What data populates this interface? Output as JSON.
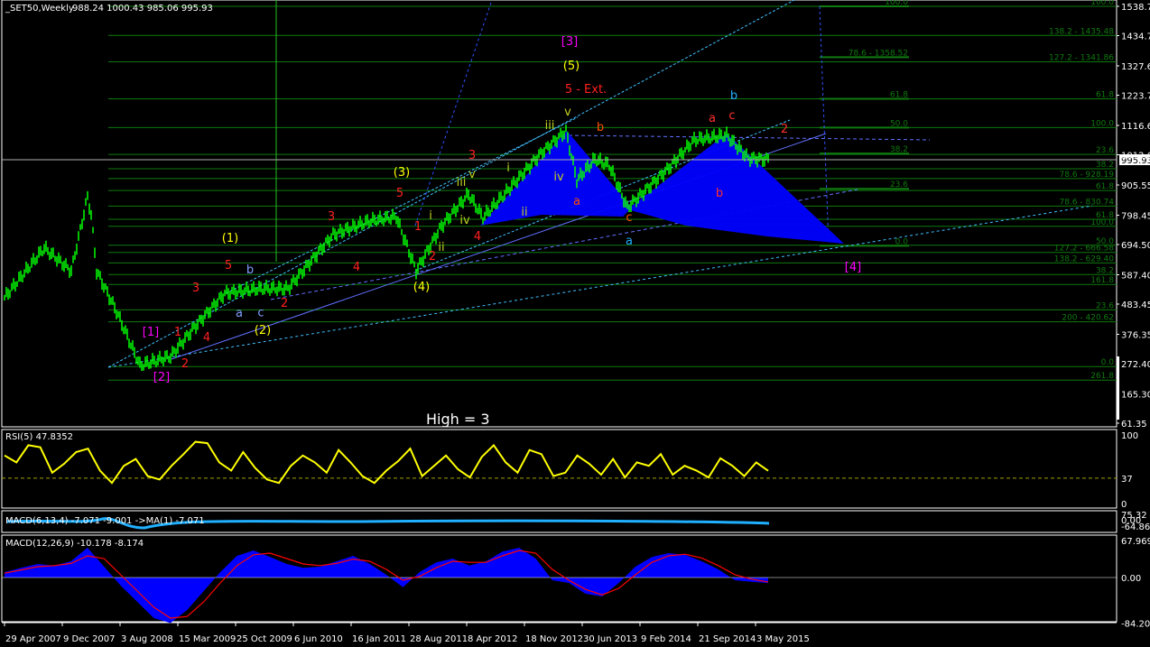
{
  "header": {
    "symbol": "_SET50,Weekly",
    "ohlc": "988.24 1000.43 985.06 995.93"
  },
  "current_price_label": "995.93",
  "annotation_text": "High = 3",
  "colors": {
    "bars": "#00ff00",
    "fib": "#0f7a0f",
    "pattern": "#0000ff",
    "rsi": "#ffff00",
    "macd_signal": "#ff0000",
    "trend_cyan": "#40c0ff",
    "trend_blue": "#4040ff"
  },
  "chart_data": [
    {
      "type": "line",
      "title": "_SET50,Weekly",
      "x_unit": "weeks since 29 Apr 2007",
      "ylim": [
        61.35,
        1538.7
      ],
      "y_ticks": [
        "1538.70",
        "1434.75",
        "1327.65",
        "1223.70",
        "1116.60",
        "1012.65",
        "905.55",
        "798.45",
        "694.50",
        "587.40",
        "483.45",
        "376.35",
        "272.40",
        "165.30",
        "61.35"
      ],
      "x_ticks": [
        "29 Apr 2007",
        "9 Dec 2007",
        "3 Aug 2008",
        "15 Mar 2009",
        "25 Oct 2009",
        "6 Jun 2010",
        "16 Jan 2011",
        "28 Aug 2011",
        "8 Apr 2012",
        "18 Nov 2012",
        "30 Jun 2013",
        "9 Feb 2014",
        "21 Sep 2014",
        "3 May 2015"
      ],
      "series": [
        {
          "name": "SET50 close",
          "points": [
            [
              0,
              506
            ],
            [
              22,
              682
            ],
            [
              37,
              601
            ],
            [
              46,
              864
            ],
            [
              48,
              800
            ],
            [
              51,
              601
            ],
            [
              62,
              458
            ],
            [
              75,
              266
            ],
            [
              92,
              298
            ],
            [
              105,
              400
            ],
            [
              122,
              522
            ],
            [
              142,
              538
            ],
            [
              157,
              538
            ],
            [
              182,
              730
            ],
            [
              202,
              777
            ],
            [
              217,
              793
            ],
            [
              228,
              601
            ],
            [
              242,
              760
            ],
            [
              257,
              873
            ],
            [
              265,
              790
            ],
            [
              277,
              873
            ],
            [
              297,
              1017
            ],
            [
              311,
              1097
            ],
            [
              317,
              922
            ],
            [
              327,
              997
            ],
            [
              335,
              975
            ],
            [
              345,
              825
            ],
            [
              367,
              960
            ],
            [
              382,
              1065
            ],
            [
              400,
              1081
            ],
            [
              412,
              1000
            ],
            [
              423,
              995.93
            ]
          ]
        }
      ],
      "fib_levels": [
        {
          "label": "100.0",
          "price": 1538.7
        },
        {
          "label": "138.2 - 1435.48",
          "price": 1435.48
        },
        {
          "label": "127.2 - 1341.86",
          "price": 1341.86
        },
        {
          "label": "61.8",
          "price": 1211
        },
        {
          "label": "100.0",
          "price": 1109
        },
        {
          "label": "23.6",
          "price": 1014
        },
        {
          "label": "38.2",
          "price": 963
        },
        {
          "label": "78.6 - 928.19",
          "price": 928.19
        },
        {
          "label": "61.8",
          "price": 886
        },
        {
          "label": "78.6 - 830.74",
          "price": 830.74
        },
        {
          "label": "61.8",
          "price": 784
        },
        {
          "label": "100.0",
          "price": 759
        },
        {
          "label": "50.0",
          "price": 692
        },
        {
          "label": "127.2 - 666.58",
          "price": 666.58
        },
        {
          "label": "138.2 - 629.40",
          "price": 629.4
        },
        {
          "label": "38.2",
          "price": 588
        },
        {
          "label": "161.8",
          "price": 553
        },
        {
          "label": "23.6",
          "price": 463
        },
        {
          "label": "200 - 420.62",
          "price": 420.62
        },
        {
          "label": "0.0",
          "price": 262
        },
        {
          "label": "261.8",
          "price": 214
        }
      ],
      "fib_levels_mid": [
        {
          "label": "100.0",
          "price": 1538.7
        },
        {
          "label": "78.6 - 1358.52",
          "price": 1358.52
        },
        {
          "label": "61.8",
          "price": 1211
        },
        {
          "label": "50.0",
          "price": 1109
        },
        {
          "label": "38.2",
          "price": 1017
        },
        {
          "label": "23.6",
          "price": 892
        },
        {
          "label": "0.0",
          "price": 690
        }
      ],
      "wave_labels": [
        {
          "t": "[1]",
          "c": "#ff00ff",
          "w": 81,
          "p": 371
        },
        {
          "t": "[2]",
          "c": "#ff00ff",
          "w": 87,
          "p": 211
        },
        {
          "t": "[3]",
          "c": "#ff00ff",
          "w": 313,
          "p": 1401
        },
        {
          "t": "[4]",
          "c": "#ff00ff",
          "w": 470,
          "p": 602
        },
        {
          "t": "(1)",
          "c": "#ffff00",
          "w": 125,
          "p": 704
        },
        {
          "t": "(2)",
          "c": "#ffff00",
          "w": 143,
          "p": 378
        },
        {
          "t": "(3)",
          "c": "#ffff00",
          "w": 220,
          "p": 937
        },
        {
          "t": "(4)",
          "c": "#ffff00",
          "w": 231,
          "p": 531
        },
        {
          "t": "(5)",
          "c": "#ffff00",
          "w": 314,
          "p": 1315
        },
        {
          "t": "5 - Ext.",
          "c": "#ff2020",
          "w": 322,
          "p": 1232
        },
        {
          "t": "1",
          "c": "#ff2020",
          "w": 96,
          "p": 371
        },
        {
          "t": "2",
          "c": "#ff2020",
          "w": 100,
          "p": 259
        },
        {
          "t": "3",
          "c": "#ff2020",
          "w": 106,
          "p": 528
        },
        {
          "t": "4",
          "c": "#ff2020",
          "w": 112,
          "p": 352
        },
        {
          "t": "5",
          "c": "#ff2020",
          "w": 124,
          "p": 608
        },
        {
          "t": "2",
          "c": "#ff2020",
          "w": 155,
          "p": 474
        },
        {
          "t": "3",
          "c": "#ff2020",
          "w": 181,
          "p": 781
        },
        {
          "t": "4",
          "c": "#ff2020",
          "w": 195,
          "p": 602
        },
        {
          "t": "5",
          "c": "#ff2020",
          "w": 219,
          "p": 864
        },
        {
          "t": "1",
          "c": "#ff2020",
          "w": 229,
          "p": 746
        },
        {
          "t": "2",
          "c": "#ff2020",
          "w": 237,
          "p": 640
        },
        {
          "t": "3",
          "c": "#ff2020",
          "w": 259,
          "p": 998
        },
        {
          "t": "4",
          "c": "#ff2020",
          "w": 262,
          "p": 710
        },
        {
          "t": "a",
          "c": "#ff3030",
          "w": 392,
          "p": 1129
        },
        {
          "t": "c",
          "c": "#ff3030",
          "w": 403,
          "p": 1139
        },
        {
          "t": "b",
          "c": "#ff3030",
          "w": 396,
          "p": 864
        },
        {
          "t": "2",
          "c": "#ff3030",
          "w": 432,
          "p": 1091
        },
        {
          "t": "b",
          "c": "#ff5000",
          "w": 330,
          "p": 1097
        },
        {
          "t": "a",
          "c": "#ff5000",
          "w": 317,
          "p": 835
        },
        {
          "t": "c",
          "c": "#ff5000",
          "w": 346,
          "p": 778
        },
        {
          "t": "b",
          "c": "#20b0ff",
          "w": 404,
          "p": 1209
        },
        {
          "t": "a",
          "c": "#20b0ff",
          "w": 346,
          "p": 694
        },
        {
          "t": "a",
          "c": "#80a0ff",
          "w": 130,
          "p": 438
        },
        {
          "t": "b",
          "c": "#80a0ff",
          "w": 136,
          "p": 592
        },
        {
          "t": "c",
          "c": "#80a0ff",
          "w": 142,
          "p": 441
        },
        {
          "t": "i",
          "c": "#c0d020",
          "w": 236,
          "p": 784
        },
        {
          "t": "ii",
          "c": "#c0d020",
          "w": 242,
          "p": 672
        },
        {
          "t": "iii",
          "c": "#c0d020",
          "w": 253,
          "p": 902
        },
        {
          "t": "iv",
          "c": "#c0d020",
          "w": 255,
          "p": 768
        },
        {
          "t": "v",
          "c": "#c0d020",
          "w": 259,
          "p": 931
        },
        {
          "t": "i",
          "c": "#c0d020",
          "w": 279,
          "p": 953
        },
        {
          "t": "ii",
          "c": "#c0d020",
          "w": 288,
          "p": 797
        },
        {
          "t": "iii",
          "c": "#c0d020",
          "w": 302,
          "p": 1104
        },
        {
          "t": "iv",
          "c": "#c0d020",
          "w": 307,
          "p": 921
        },
        {
          "t": "v",
          "c": "#c0d020",
          "w": 312,
          "p": 1152
        }
      ]
    },
    {
      "type": "line",
      "title": "RSI(5) 47.8352",
      "ylim": [
        0,
        100
      ],
      "y_ticks": [
        "100",
        "37",
        "0"
      ],
      "level": 37,
      "step_weeks": 6,
      "values": [
        70,
        60,
        85,
        82,
        45,
        58,
        75,
        80,
        48,
        30,
        55,
        65,
        40,
        35,
        55,
        72,
        90,
        88,
        60,
        48,
        75,
        52,
        35,
        30,
        55,
        70,
        60,
        45,
        78,
        60,
        40,
        30,
        48,
        62,
        80,
        40,
        55,
        70,
        50,
        38,
        68,
        85,
        60,
        45,
        78,
        72,
        40,
        45,
        70,
        58,
        42,
        65,
        38,
        60,
        55,
        72,
        42,
        55,
        48,
        38,
        66,
        55,
        40,
        60,
        47.8
      ]
    },
    {
      "type": "line",
      "title": "MACD(6,13,4) -7.071 -9.001 ->MA(1) -7.071",
      "y_ticks": [
        "75.32",
        "0.00",
        "-64.863"
      ]
    },
    {
      "type": "bar",
      "title": "MACD(12,26,9) -10.178 -8.174",
      "ylim": [
        -84.205,
        67.969
      ],
      "y_ticks": [
        "67.969",
        "0.00",
        "-84.205"
      ],
      "step_weeks": 8,
      "histogram": [
        10,
        18,
        25,
        22,
        30,
        55,
        20,
        -15,
        -45,
        -75,
        -84,
        -60,
        -25,
        10,
        40,
        50,
        38,
        25,
        18,
        20,
        30,
        40,
        25,
        5,
        -18,
        10,
        28,
        35,
        22,
        30,
        48,
        55,
        35,
        -5,
        -10,
        -30,
        -35,
        -10,
        20,
        38,
        45,
        42,
        30,
        15,
        -5,
        -8,
        -10.2
      ],
      "signal": [
        8,
        14,
        20,
        22,
        26,
        40,
        35,
        5,
        -25,
        -55,
        -75,
        -72,
        -45,
        -10,
        22,
        42,
        45,
        35,
        25,
        22,
        26,
        34,
        30,
        15,
        -5,
        2,
        18,
        30,
        28,
        28,
        40,
        50,
        45,
        15,
        -5,
        -22,
        -32,
        -20,
        5,
        28,
        40,
        43,
        36,
        22,
        5,
        -3,
        -8.2
      ]
    }
  ]
}
